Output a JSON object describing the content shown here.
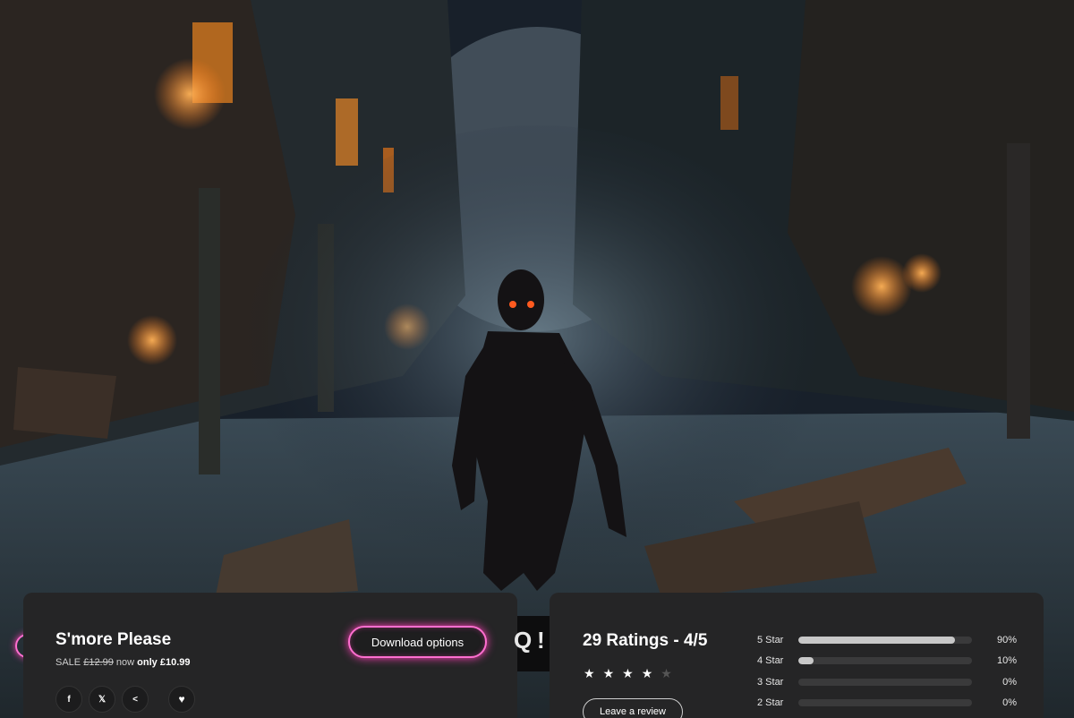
{
  "scene": {
    "description_icon": "game-key-art",
    "accent_color": "#ff6fd0"
  },
  "product": {
    "title": "S'more Please",
    "sale_prefix": "SALE",
    "old_price": "£12.99",
    "now_text": "now",
    "only_text": "only",
    "new_price": "£10.99",
    "download_label": "Download options",
    "share_icons": [
      "f",
      "𝕏",
      "<"
    ],
    "wishlist_icon": "♥"
  },
  "gap": {
    "glyph_left": "Q",
    "glyph_right": "!"
  },
  "ratings": {
    "title": "29 Ratings - 4/5",
    "stars_filled": 4,
    "stars_total": 5,
    "review_label": "Leave a review",
    "distribution": [
      {
        "label": "5 Star",
        "percent": 90,
        "percent_text": "90%"
      },
      {
        "label": "4 Star",
        "percent": 10,
        "percent_text": "10%"
      },
      {
        "label": "3 Star",
        "percent": 0,
        "percent_text": "0%"
      },
      {
        "label": "2 Star",
        "percent": 0,
        "percent_text": "0%"
      }
    ]
  }
}
